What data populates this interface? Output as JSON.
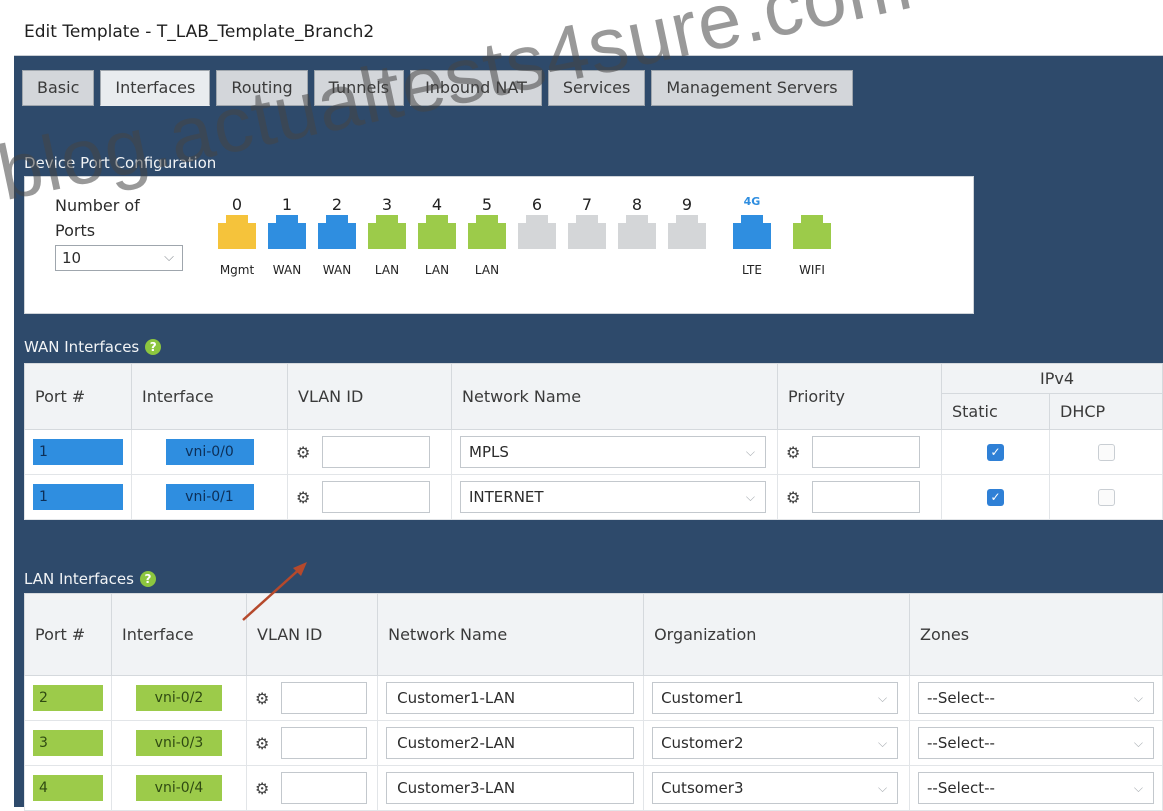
{
  "window": {
    "title": "Edit Template - T_LAB_Template_Branch2"
  },
  "tabs": [
    {
      "label": "Basic"
    },
    {
      "label": "Interfaces"
    },
    {
      "label": "Routing"
    },
    {
      "label": "Tunnels"
    },
    {
      "label": "Inbound NAT"
    },
    {
      "label": "Services"
    },
    {
      "label": "Management Servers"
    }
  ],
  "active_tab": "Interfaces",
  "device_port": {
    "section_title": "Device Port Configuration",
    "number_of_ports_label": "Number of Ports",
    "number_of_ports_value": "10",
    "ports": [
      {
        "num": "0",
        "label": "Mgmt",
        "color": "#f5c33b"
      },
      {
        "num": "1",
        "label": "WAN",
        "color": "#2f8ee0"
      },
      {
        "num": "2",
        "label": "WAN",
        "color": "#2f8ee0"
      },
      {
        "num": "3",
        "label": "LAN",
        "color": "#9ccb4a"
      },
      {
        "num": "4",
        "label": "LAN",
        "color": "#9ccb4a"
      },
      {
        "num": "5",
        "label": "LAN",
        "color": "#9ccb4a"
      },
      {
        "num": "6",
        "label": "",
        "color": "#d4d6d8"
      },
      {
        "num": "7",
        "label": "",
        "color": "#d4d6d8"
      },
      {
        "num": "8",
        "label": "",
        "color": "#d4d6d8"
      },
      {
        "num": "9",
        "label": "",
        "color": "#d4d6d8"
      }
    ],
    "lte": {
      "badge": "4G",
      "label": "LTE",
      "color": "#2f8ee0"
    },
    "wifi": {
      "label": "WIFI",
      "color": "#9ccb4a"
    }
  },
  "wan": {
    "title": "WAN Interfaces",
    "headers": {
      "port": "Port #",
      "interface": "Interface",
      "vlan": "VLAN ID",
      "network": "Network Name",
      "priority": "Priority",
      "ipv4": "IPv4",
      "static": "Static",
      "dhcp": "DHCP"
    },
    "rows": [
      {
        "port": "1",
        "interface": "vni-0/0",
        "network": "MPLS",
        "static": true,
        "dhcp": false
      },
      {
        "port": "1",
        "interface": "vni-0/1",
        "network": "INTERNET",
        "static": true,
        "dhcp": false
      }
    ]
  },
  "lan": {
    "title": "LAN Interfaces",
    "headers": {
      "port": "Port #",
      "interface": "Interface",
      "vlan": "VLAN ID",
      "network": "Network Name",
      "org": "Organization",
      "zones": "Zones"
    },
    "rows": [
      {
        "port": "2",
        "interface": "vni-0/2",
        "network": "Customer1-LAN",
        "org": "Customer1",
        "zones": "--Select--"
      },
      {
        "port": "3",
        "interface": "vni-0/3",
        "network": "Customer2-LAN",
        "org": "Customer2",
        "zones": "--Select--"
      },
      {
        "port": "4",
        "interface": "vni-0/4",
        "network": "Customer3-LAN",
        "org": "Cutsomer3",
        "zones": "--Select--"
      }
    ]
  },
  "watermark": "blog.actualtests4sure.com",
  "icons": {
    "gear": "gear-icon",
    "help": "help-icon",
    "chevron": "chevron-down-icon",
    "check": "check-icon"
  }
}
